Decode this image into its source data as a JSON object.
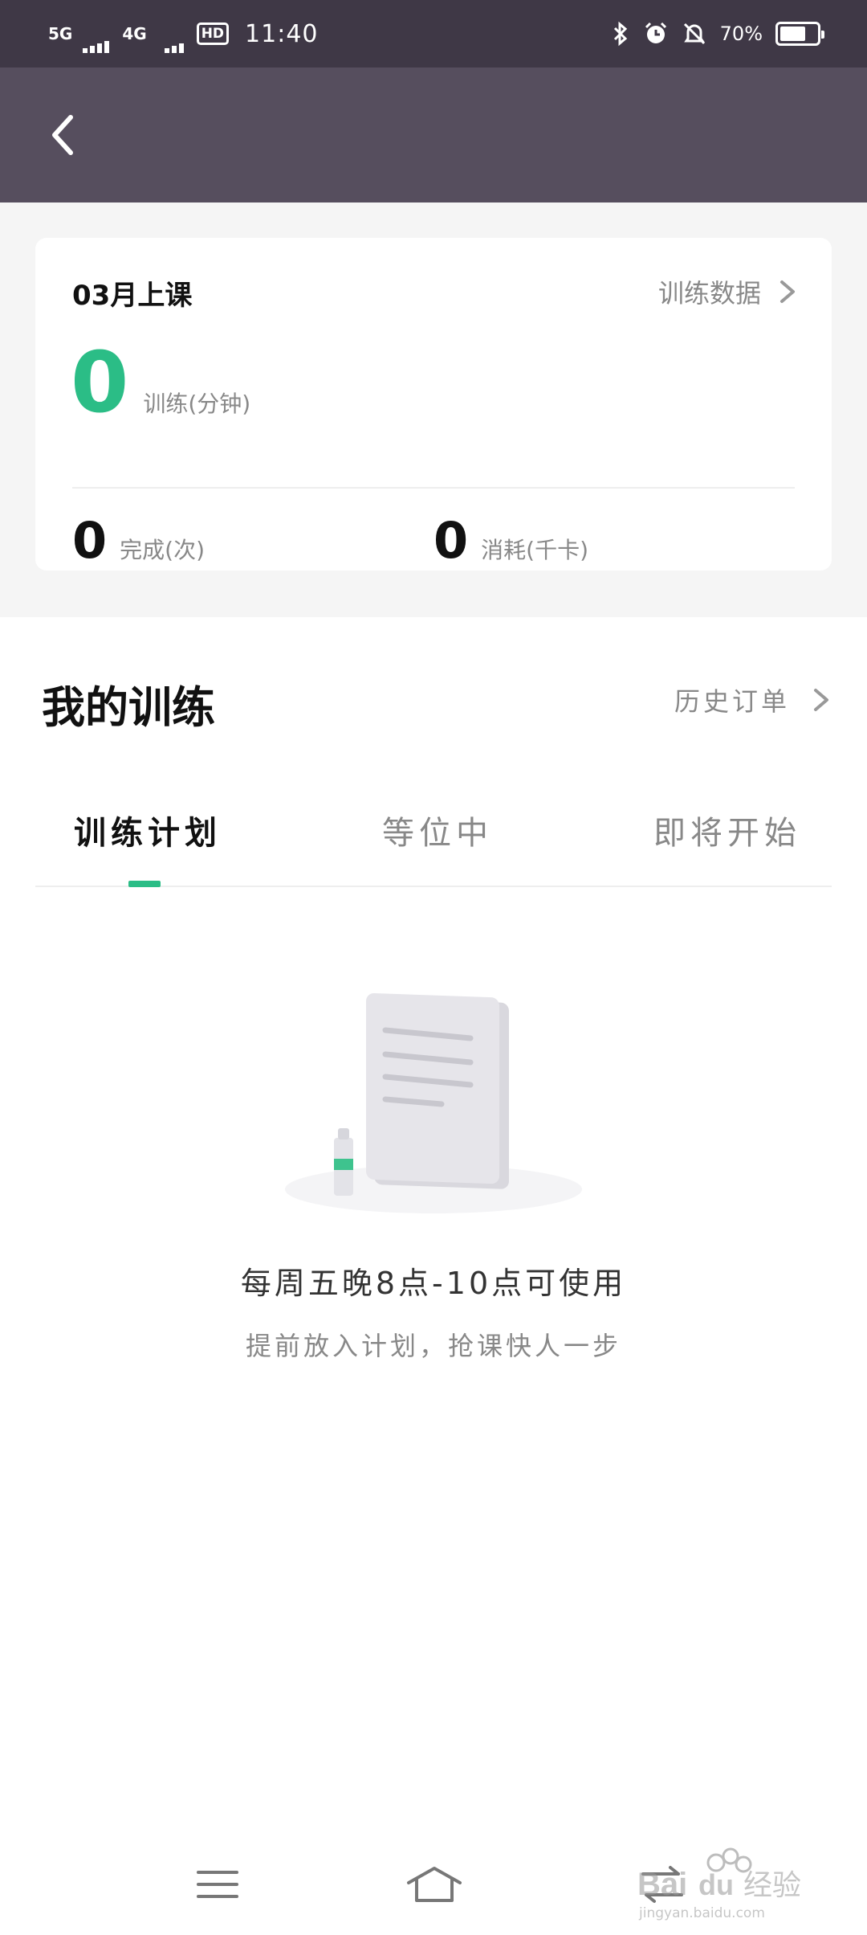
{
  "status_bar": {
    "network1": "5G",
    "network2": "4G",
    "hd_badge": "HD",
    "time": "11:40",
    "battery_text": "70%",
    "battery_level": 0.7
  },
  "stats": {
    "month_title": "03月上课",
    "data_link_label": "训练数据",
    "training_value": "0",
    "training_label": "训练(分钟)",
    "complete_value": "0",
    "complete_label": "完成(次)",
    "calorie_value": "0",
    "calorie_label": "消耗(千卡)"
  },
  "my_training": {
    "title": "我的训练",
    "history_label": "历史订单",
    "tabs": [
      {
        "label": "训练计划",
        "active": true
      },
      {
        "label": "等位中",
        "active": false
      },
      {
        "label": "即将开始",
        "active": false
      }
    ]
  },
  "empty_state": {
    "title": "每周五晚8点-10点可使用",
    "subtitle": "提前放入计划，抢课快人一步"
  },
  "watermark": {
    "text1": "Bai",
    "text2": "du",
    "text3": "经验",
    "url": "jingyan.baidu.com"
  },
  "colors": {
    "accent": "#2bbd86",
    "status_bar": "#3f3846",
    "header": "#564e5e"
  },
  "icons": {
    "back": "chevron-left-icon",
    "arrow": "chevron-right-icon",
    "nav_menu": "menu-icon",
    "nav_home": "home-icon",
    "nav_back": "back-arrow-icon"
  }
}
